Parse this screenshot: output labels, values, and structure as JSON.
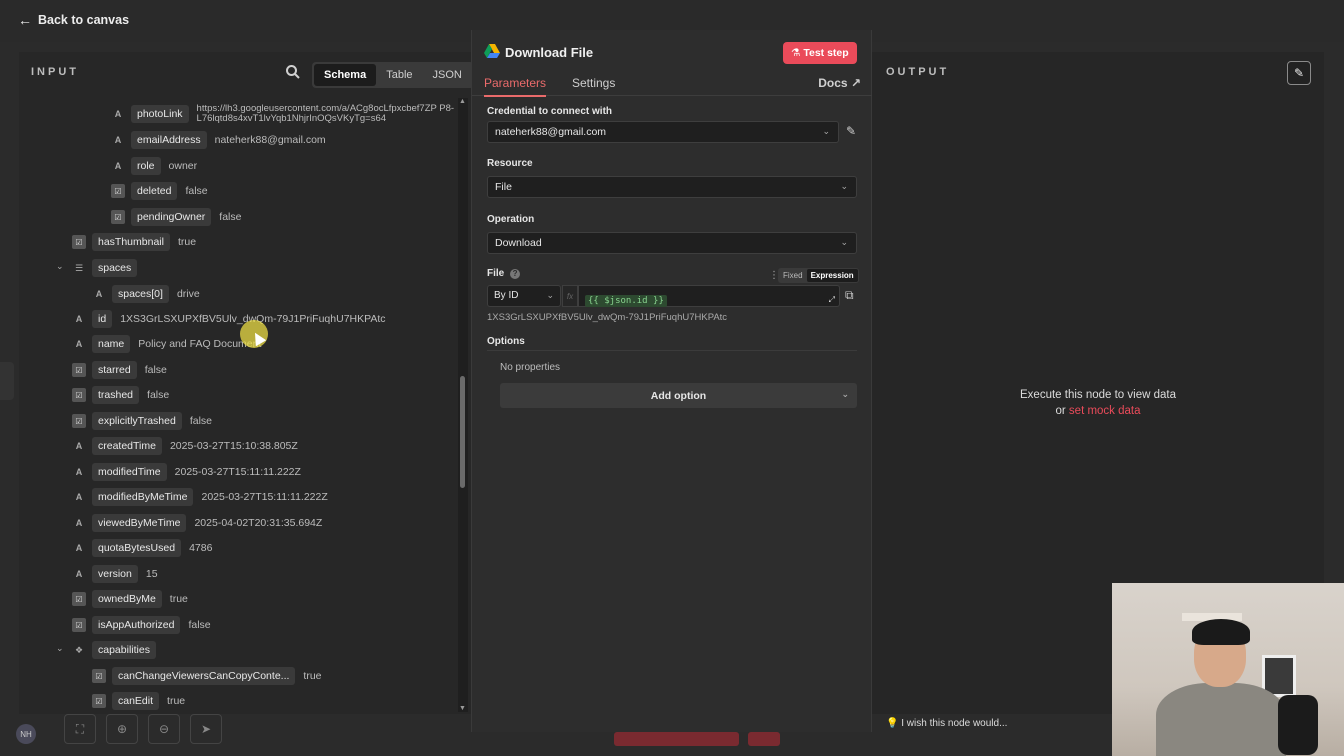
{
  "topbar": {
    "back_label": "Back to canvas"
  },
  "input": {
    "header": "INPUT",
    "view_tabs": [
      "Schema",
      "Table",
      "JSON"
    ],
    "rows": [
      {
        "key": "photoLink",
        "value": "https://lh3.googleusercontent.com/a/ACg8ocLfpxcbef7ZP P8-L76lqtd8s4xvT1lvYqb1NhjrInOQsVKyTg=s64",
        "type": "A"
      },
      {
        "key": "emailAddress",
        "value": "nateherk88@gmail.com",
        "type": "A"
      },
      {
        "key": "role",
        "value": "owner",
        "type": "A"
      },
      {
        "key": "deleted",
        "value": "false",
        "type": "bool"
      },
      {
        "key": "pendingOwner",
        "value": "false",
        "type": "bool"
      },
      {
        "key": "hasThumbnail",
        "value": "true",
        "type": "bool"
      },
      {
        "key": "spaces",
        "value": "",
        "type": "list"
      },
      {
        "key": "spaces[0]",
        "value": "drive",
        "type": "A"
      },
      {
        "key": "id",
        "value": "1XS3GrLSXUPXfBV5Ulv_dwQm-79J1PriFuqhU7HKPAtc",
        "type": "A"
      },
      {
        "key": "name",
        "value": "Policy and FAQ Document",
        "type": "A"
      },
      {
        "key": "starred",
        "value": "false",
        "type": "bool"
      },
      {
        "key": "trashed",
        "value": "false",
        "type": "bool"
      },
      {
        "key": "explicitlyTrashed",
        "value": "false",
        "type": "bool"
      },
      {
        "key": "createdTime",
        "value": "2025-03-27T15:10:38.805Z",
        "type": "A"
      },
      {
        "key": "modifiedTime",
        "value": "2025-03-27T15:11:11.222Z",
        "type": "A"
      },
      {
        "key": "modifiedByMeTime",
        "value": "2025-03-27T15:11:11.222Z",
        "type": "A"
      },
      {
        "key": "viewedByMeTime",
        "value": "2025-04-02T20:31:35.694Z",
        "type": "A"
      },
      {
        "key": "quotaBytesUsed",
        "value": "4786",
        "type": "A"
      },
      {
        "key": "version",
        "value": "15",
        "type": "A"
      },
      {
        "key": "ownedByMe",
        "value": "true",
        "type": "bool"
      },
      {
        "key": "isAppAuthorized",
        "value": "false",
        "type": "bool"
      },
      {
        "key": "capabilities",
        "value": "",
        "type": "obj"
      },
      {
        "key": "canChangeViewersCanCopyConte...",
        "value": "true",
        "type": "bool"
      },
      {
        "key": "canEdit",
        "value": "true",
        "type": "bool"
      }
    ]
  },
  "node": {
    "title": "Download File",
    "test_button": "Test step",
    "tabs": [
      "Parameters",
      "Settings"
    ],
    "docs": "Docs",
    "credential_label": "Credential to connect with",
    "credential_value": "nateherk88@gmail.com",
    "resource_label": "Resource",
    "resource_value": "File",
    "operation_label": "Operation",
    "operation_value": "Download",
    "file_label": "File",
    "mode_fixed": "Fixed",
    "mode_expression": "Expression",
    "file_by": "By ID",
    "fx": "fx",
    "expression": "{{ $json.id }}",
    "resolved": "1XS3GrLSXUPXfBV5Ulv_dwQm-79J1PriFuqhU7HKPAtc",
    "options_label": "Options",
    "no_properties": "No properties",
    "add_option": "Add option"
  },
  "output": {
    "header": "OUTPUT",
    "message_line1": "Execute this node to view data",
    "message_or": "or",
    "mock_link": "set mock data"
  },
  "hint": "I wish this node would...",
  "avatar": "NH",
  "colors": {
    "accent": "#ea4b5a",
    "background": "#2b2b2b",
    "expression_green": "#88d38e"
  }
}
